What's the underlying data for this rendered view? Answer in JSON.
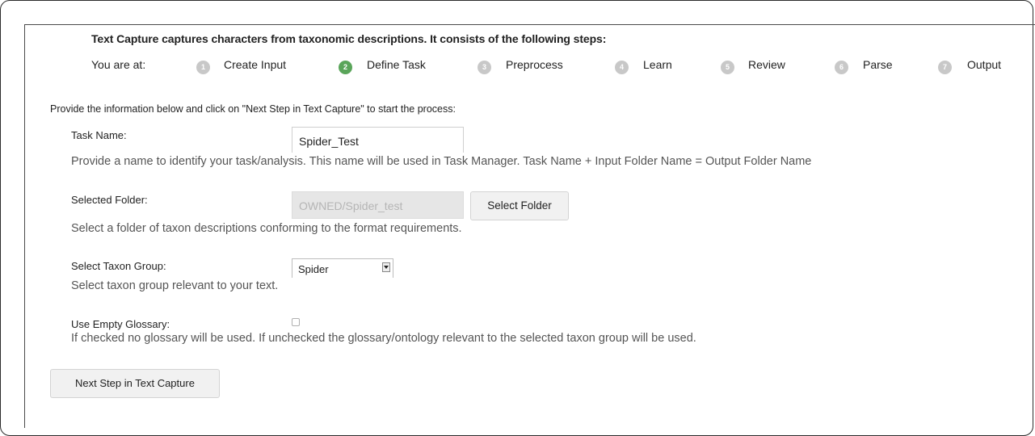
{
  "intro_text": "Text Capture captures characters from taxonomic descriptions. It consists of the following steps:",
  "progress": {
    "you_are_at_label": "You are at:",
    "active_step": 2,
    "steps": [
      {
        "number": "1",
        "label": "Create Input"
      },
      {
        "number": "2",
        "label": "Define Task"
      },
      {
        "number": "3",
        "label": "Preprocess"
      },
      {
        "number": "4",
        "label": "Learn"
      },
      {
        "number": "5",
        "label": "Review"
      },
      {
        "number": "6",
        "label": "Parse"
      },
      {
        "number": "7",
        "label": "Output"
      }
    ]
  },
  "instructions": "Provide the information below and click on \"Next Step in Text Capture\" to start the process:",
  "task_name": {
    "label": "Task Name:",
    "value": "Spider_Test",
    "help": "Provide a name to identify your task/analysis. This name will be used in Task Manager. Task Name + Input Folder Name = Output Folder Name"
  },
  "selected_folder": {
    "label": "Selected Folder:",
    "value": "OWNED/Spider_test",
    "button_label": "Select Folder",
    "help": "Select a folder of taxon descriptions conforming to the format requirements."
  },
  "taxon_group": {
    "label": "Select Taxon Group:",
    "selected": "Spider",
    "help": "Select taxon group relevant to your text."
  },
  "empty_glossary": {
    "label": "Use Empty Glossary:",
    "checked": false,
    "help": "If checked no glossary will be used. If unchecked the glossary/ontology relevant to the selected taxon group will be used."
  },
  "next_button_label": "Next Step in Text Capture",
  "colors": {
    "active_step": "#5aa55a",
    "inactive_step": "#c8c8c8",
    "disabled_field_bg": "#e6e6e6"
  }
}
